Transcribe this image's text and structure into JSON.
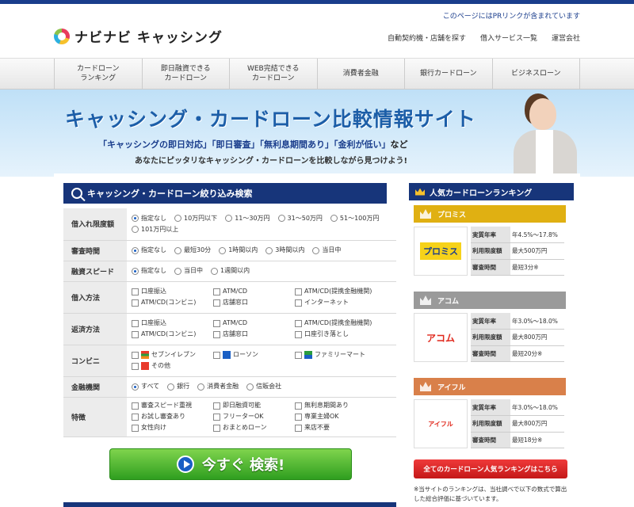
{
  "header": {
    "pr_notice": "このページにはPRリンクが含まれています",
    "logo_text": "ナビナビ キャッシング",
    "links": [
      "自動契約機・店舗を探す",
      "借入サービス一覧",
      "運営会社"
    ]
  },
  "nav": [
    "カードローン\nランキング",
    "即日融資できる\nカードローン",
    "WEB完結できる\nカードローン",
    "消費者金融",
    "銀行カードローン",
    "ビジネスローン"
  ],
  "hero": {
    "title": "キャッシング・カードローン比較情報サイト",
    "subtitle_parts": [
      "「キャッシングの即日対応」",
      "「即日審査」",
      "「無利息期間あり」",
      "「金利が低い」",
      "など"
    ],
    "tagline": "あなたにピッタリなキャッシング・カードローンを比較しながら見つけよう!"
  },
  "search": {
    "title": "キャッシング・カードローン絞り込み検索",
    "button": "今すぐ 検索!",
    "rows": [
      {
        "label": "借入れ限度額",
        "type": "radio",
        "options": [
          "指定なし",
          "10万円以下",
          "11〜30万円",
          "31〜50万円",
          "51〜100万円",
          "101万円以上"
        ],
        "selected": 0
      },
      {
        "label": "審査時間",
        "type": "radio",
        "options": [
          "指定なし",
          "最短30分",
          "1時間以内",
          "3時間以内",
          "当日中"
        ],
        "selected": 0
      },
      {
        "label": "融資スピード",
        "type": "radio",
        "options": [
          "指定なし",
          "当日中",
          "1週間以内"
        ],
        "selected": 0
      },
      {
        "label": "借入方法",
        "type": "check",
        "options": [
          "口座振込",
          "ATM/CD",
          "ATM/CD(提携金融機関)",
          "ATM/CD(コンビニ)",
          "店舗窓口",
          "インターネット"
        ]
      },
      {
        "label": "返済方法",
        "type": "check",
        "options": [
          "口座振込",
          "ATM/CD",
          "ATM/CD(提携金融機関)",
          "ATM/CD(コンビニ)",
          "店舗窓口",
          "口座引き落とし"
        ]
      },
      {
        "label": "コンビニ",
        "type": "check",
        "options": [
          "セブンイレブン",
          "ローソン",
          "ファミリーマート",
          "その他"
        ]
      },
      {
        "label": "金融機関",
        "type": "radio",
        "options": [
          "すべて",
          "銀行",
          "消費者金融",
          "信販会社"
        ],
        "selected": 0
      },
      {
        "label": "特徴",
        "type": "check",
        "options": [
          "審査スピード重視",
          "即日融資可能",
          "無利息期間あり",
          "お試し審査あり",
          "フリーターOK",
          "専業主婦OK",
          "女性向け",
          "おまとめローン",
          "来店不要"
        ]
      }
    ]
  },
  "ranking": {
    "title": "人気カードローンランキング",
    "items": [
      {
        "name": "プロミス",
        "color": "#e0b012",
        "logo": "プロミス",
        "rate": "年4.5%〜17.8%",
        "limit": "最大500万円",
        "time": "最短3分※"
      },
      {
        "name": "アコム",
        "color": "#9a9a9a",
        "logo": "アコム",
        "rate": "年3.0%〜18.0%",
        "limit": "最大800万円",
        "time": "最短20分※"
      },
      {
        "name": "アイフル",
        "color": "#d9804a",
        "logo": "アイフル",
        "rate": "年3.0%〜18.0%",
        "limit": "最大800万円",
        "time": "最短18分※"
      }
    ],
    "keys": [
      "実質年率",
      "利用限度額",
      "審査時間"
    ],
    "all_button": "全てのカードローン人気ランキングはこちら",
    "note": "※当サイトのランキングは、当社調べで以下の数式で算出した総合評価に基づいています。"
  }
}
